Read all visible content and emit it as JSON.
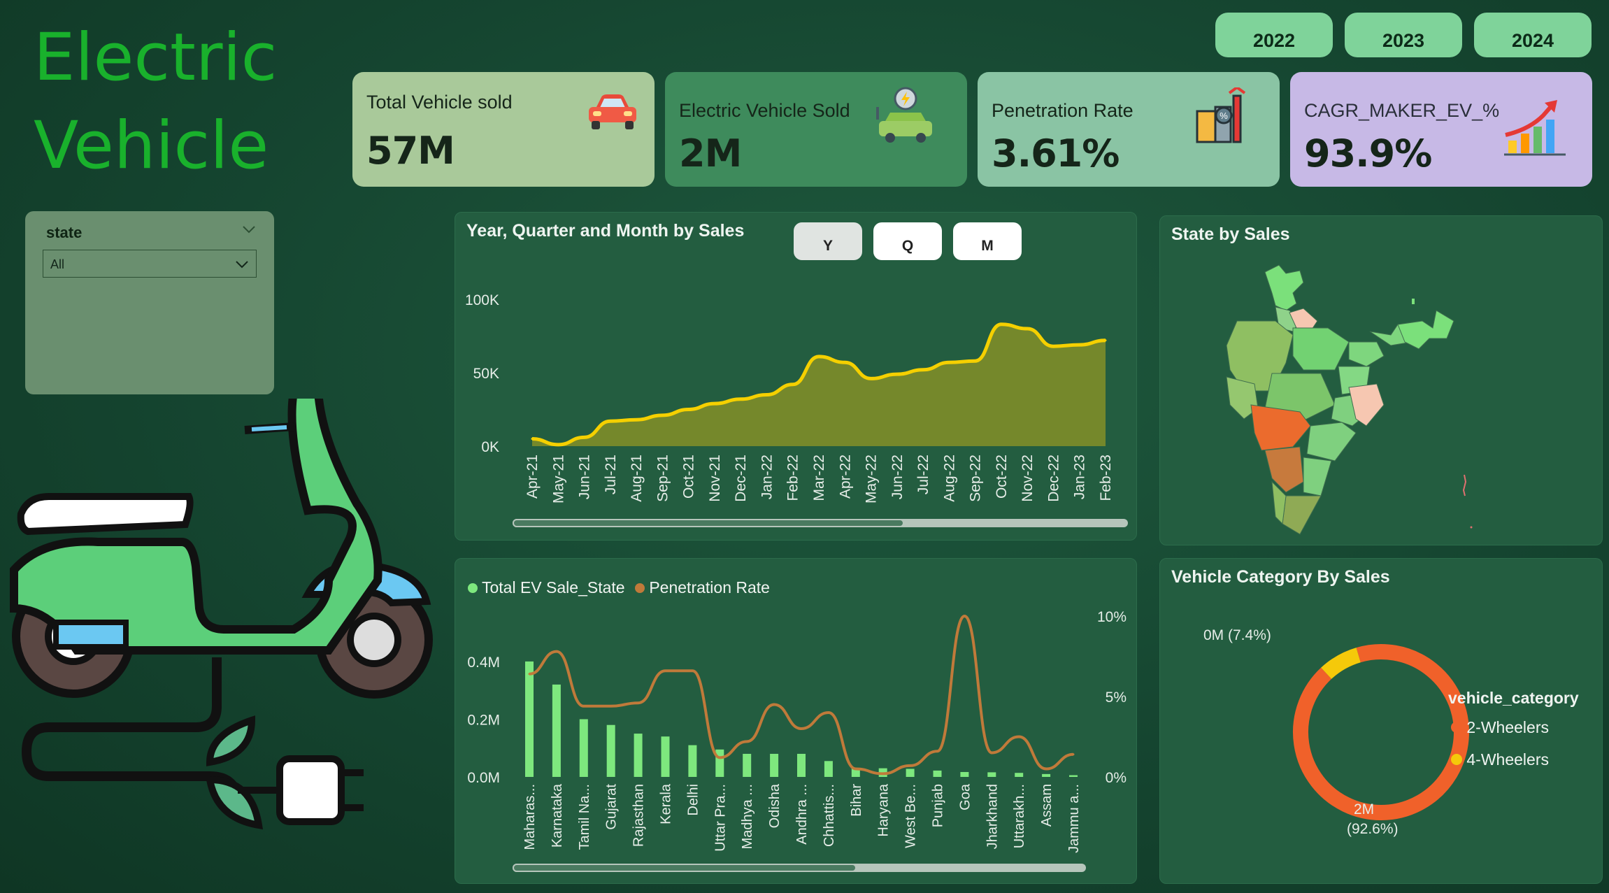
{
  "title": [
    "Electric",
    "Vehicle"
  ],
  "years": [
    "2022",
    "2023",
    "2024"
  ],
  "kpis": [
    {
      "label": "Total Vehicle sold",
      "value": "57M",
      "icon": "car-icon",
      "color": "#a9c99a"
    },
    {
      "label": "Electric Vehicle Sold",
      "value": "2M",
      "icon": "ev-charging-car-icon",
      "color": "#3e8b5c"
    },
    {
      "label": "Penetration Rate",
      "value": "3.61%",
      "icon": "factory-icon",
      "color": "#8ac4a4"
    },
    {
      "label": "CAGR_MAKER_EV_%",
      "value": "93.9%",
      "icon": "growth-chart-icon",
      "color": "#c7b9e6"
    }
  ],
  "slicer": {
    "label": "state",
    "value": "All"
  },
  "trend": {
    "title": "Year, Quarter and Month by Sales",
    "buttons": [
      "Y",
      "Q",
      "M"
    ],
    "active": "M"
  },
  "statemap": {
    "title": "State by Sales"
  },
  "donut_panel": {
    "title": "Vehicle Category By Sales"
  },
  "chart_data": [
    {
      "type": "area",
      "title": "Year, Quarter and Month by Sales",
      "x": [
        "Apr-21",
        "May-21",
        "Jun-21",
        "Jul-21",
        "Aug-21",
        "Sep-21",
        "Oct-21",
        "Nov-21",
        "Dec-21",
        "Jan-22",
        "Feb-22",
        "Mar-22",
        "Apr-22",
        "May-22",
        "Jun-22",
        "Jul-22",
        "Aug-22",
        "Sep-22",
        "Oct-22",
        "Nov-22",
        "Dec-22",
        "Jan-23",
        "Feb-23"
      ],
      "series": [
        {
          "values": [
            5000,
            1000,
            6000,
            17000,
            18000,
            21000,
            25000,
            29000,
            32000,
            35000,
            42000,
            61000,
            57000,
            46000,
            49000,
            52000,
            57000,
            58000,
            83000,
            80000,
            68000,
            69000,
            72000
          ]
        }
      ],
      "yticks": [
        "0K",
        "50K",
        "100K"
      ],
      "ylim": [
        0,
        100000
      ],
      "color": "#f5d000",
      "fill": "#7a8a2a"
    },
    {
      "type": "bar",
      "categories": [
        "Maharas...",
        "Karnataka",
        "Tamil Na...",
        "Gujarat",
        "Rajasthan",
        "Kerala",
        "Delhi",
        "Uttar Pra...",
        "Madhya ...",
        "Odisha",
        "Andhra ...",
        "Chhattis...",
        "Bihar",
        "Haryana",
        "West Be...",
        "Punjab",
        "Goa",
        "Jharkhand",
        "Uttarakh...",
        "Assam",
        "Jammu a..."
      ],
      "series": [
        {
          "name": "Total EV Sale_State",
          "values": [
            0.4,
            0.32,
            0.2,
            0.18,
            0.15,
            0.14,
            0.11,
            0.095,
            0.08,
            0.08,
            0.08,
            0.055,
            0.03,
            0.03,
            0.028,
            0.022,
            0.017,
            0.016,
            0.014,
            0.01,
            0.006
          ],
          "color": "#7ee87e"
        },
        {
          "name": "Penetration Rate",
          "values": [
            6.4,
            7.8,
            4.4,
            4.4,
            4.6,
            6.6,
            6.6,
            1.2,
            2.2,
            4.5,
            3.0,
            4.0,
            0.5,
            0.2,
            0.7,
            1.6,
            10.0,
            1.5,
            2.5,
            0.5,
            1.4
          ],
          "color": "#c07a3a"
        }
      ],
      "yticks_left": [
        "0.0M",
        "0.2M",
        "0.4M"
      ],
      "yticks_right": [
        "0%",
        "5%",
        "10%"
      ],
      "ylim_left": [
        0,
        0.47
      ],
      "ylim_right": [
        0,
        10
      ]
    },
    {
      "type": "pie",
      "legend_title": "vehicle_category",
      "categories": [
        "2-Wheelers",
        "4-Wheelers"
      ],
      "values": [
        92.6,
        7.4
      ],
      "labels": [
        "2M",
        "(92.6%)",
        "0M (7.4%)"
      ],
      "colors": [
        "#f0612a",
        "#f5c90a"
      ]
    }
  ]
}
